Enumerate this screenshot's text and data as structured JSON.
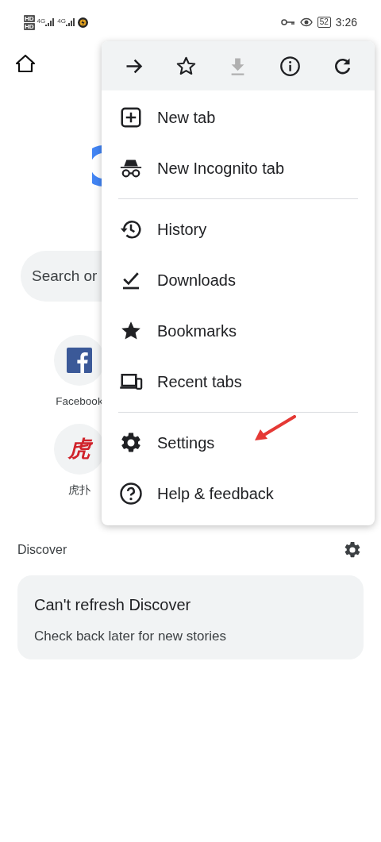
{
  "status_bar": {
    "sim_badges": [
      "HD",
      "HD"
    ],
    "networks": [
      "4G",
      "4G"
    ],
    "battery": "52",
    "time": "3:26"
  },
  "search": {
    "placeholder": "Search or"
  },
  "shortcuts": [
    {
      "kind": "facebook",
      "label": "Facebook"
    },
    {
      "kind": "glyph",
      "glyph": "虎",
      "label": "虎扑"
    }
  ],
  "discover": {
    "title": "Discover",
    "card_title": "Can't refresh Discover",
    "card_text": "Check back later for new stories"
  },
  "menu": {
    "toolbar": [
      {
        "kind": "forward",
        "disabled": false
      },
      {
        "kind": "bookmark",
        "disabled": false
      },
      {
        "kind": "download",
        "disabled": true
      },
      {
        "kind": "info",
        "disabled": false
      },
      {
        "kind": "reload",
        "disabled": false
      }
    ],
    "items": [
      {
        "kind": "new-tab",
        "label": "New tab"
      },
      {
        "kind": "incognito",
        "label": "New Incognito tab"
      },
      {
        "kind": "divider"
      },
      {
        "kind": "history",
        "label": "History"
      },
      {
        "kind": "downloads",
        "label": "Downloads"
      },
      {
        "kind": "bookmarks",
        "label": "Bookmarks"
      },
      {
        "kind": "recent-tabs",
        "label": "Recent tabs"
      },
      {
        "kind": "divider"
      },
      {
        "kind": "settings",
        "label": "Settings"
      },
      {
        "kind": "help",
        "label": "Help & feedback"
      }
    ]
  }
}
